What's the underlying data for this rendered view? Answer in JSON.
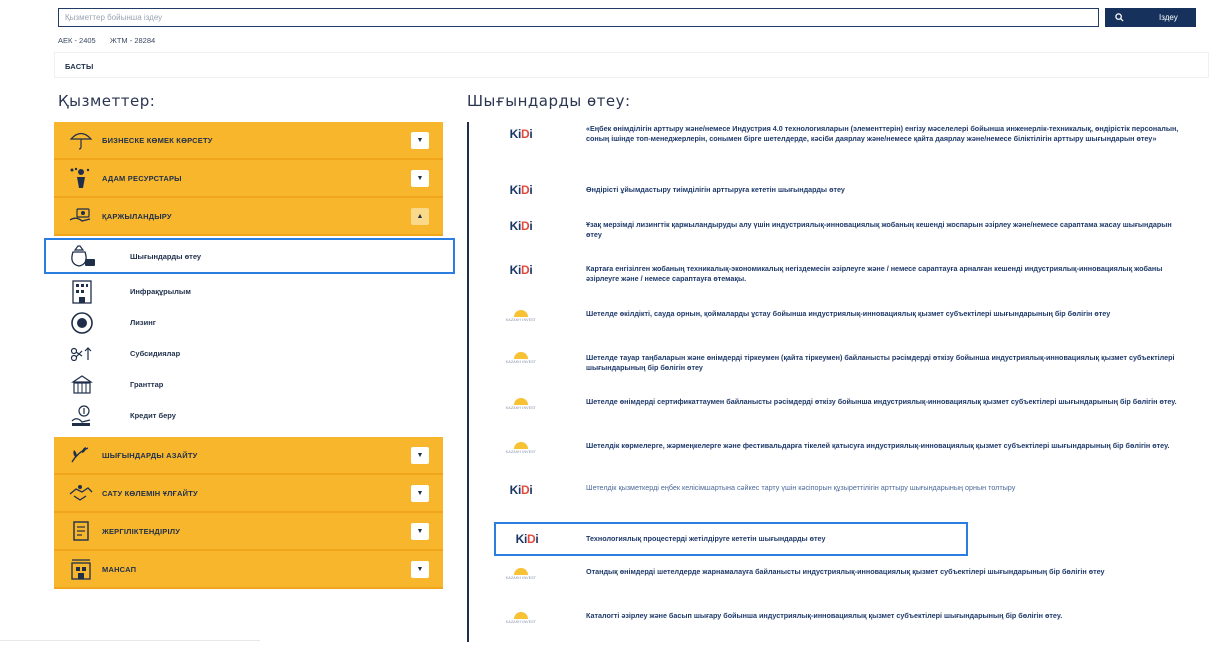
{
  "search": {
    "placeholder": "Қызметтер бойынша іздеу",
    "button_label": "Іздеу"
  },
  "rates": {
    "aek": "АЕК - 2405",
    "zhtm": "ЖТМ - 28284"
  },
  "breadcrumb": "БАСТЫ",
  "services": {
    "title": "Қызметтер:",
    "categories": [
      {
        "label": "БИЗНЕСКЕ КӨМЕК КӨРСЕТУ",
        "icon": "umbrella-icon",
        "open": false
      },
      {
        "label": "АДАМ РЕСУРСТАРЫ",
        "icon": "people-icon",
        "open": false
      },
      {
        "label": "ҚАРЖЫЛАНДЫРУ",
        "icon": "money-hand-icon",
        "open": true
      },
      {
        "label": "ШЫҒЫНДАРДЫ АЗАЙТУ",
        "icon": "plant-icon",
        "open": false
      },
      {
        "label": "САТУ КӨЛЕМІН ҰЛҒАЙТУ",
        "icon": "handshake-icon",
        "open": false
      },
      {
        "label": "ЖЕРГІЛІКТЕНДІРІЛУ",
        "icon": "document-icon",
        "open": false
      },
      {
        "label": "МАНСАП",
        "icon": "career-icon",
        "open": false
      }
    ],
    "subitems": [
      {
        "label": "Шығындарды өтеу",
        "icon": "money-bag-icon",
        "active": true
      },
      {
        "label": "Инфрақұрылым",
        "icon": "building-icon",
        "active": false
      },
      {
        "label": "Лизинг",
        "icon": "leasing-icon",
        "active": false
      },
      {
        "label": "Субсидиялар",
        "icon": "subsidy-icon",
        "active": false
      },
      {
        "label": "Гранттар",
        "icon": "grant-icon",
        "active": false
      },
      {
        "label": "Кредит беру",
        "icon": "credit-icon",
        "active": false
      }
    ]
  },
  "expenses": {
    "title": "Шығындарды өтеу:",
    "items": [
      {
        "logo": "KIDI",
        "text": "«Еңбек өнімділігін арттыру және/немесе Индустрия 4.0 технологияларын (элементтерін) енгізу мәселелері бойынша инженерлік-техникалық, өндірістік персоналын, соның ішінде топ-менеджерлерін, сонымен бірге шетелдерде, кәсіби даярлау және/немесе қайта даярлау және/немесе біліктілігін арттыру шығындарын өтеу»"
      },
      {
        "logo": "KIDI",
        "text": "Өндірісті ұйымдастыру тиімділігін арттыруға кететін шығындарды өтеу"
      },
      {
        "logo": "KIDI",
        "text": "Ұзақ мерзімді лизингтік қаржыландыруды алу үшін индустриялық-инновациялық жобаның кешенді жоспарын әзірлеу және/немесе сараптама жасау шығындарын өтеу"
      },
      {
        "logo": "KIDI",
        "text": "Картаға енгізілген жобаның техникалық-экономикалық негіздемесін әзірлеуге және / немесе сараптауға арналған кешенді индустриялық-инновациялық жобаны әзірлеуге және / немесе сараптауға өтемақы."
      },
      {
        "logo": "KAZAKH INVEST",
        "text": "Шетелде өкілдікті, сауда орнын, қоймаларды ұстау бойынша индустриялық-инновациялық қызмет субъектілері шығындарының бір бөлігін өтеу"
      },
      {
        "logo": "KAZAKH INVEST",
        "text": "Шетелде тауар таңбаларын және өнімдерді тіркеумен (қайта тіркеумен) байланысты рәсімдерді өткізу бойынша индустриялық-инновациялық қызмет субъектілері шығындарының бір бөлігін өтеу"
      },
      {
        "logo": "KAZAKH INVEST",
        "text": "Шетелде өнімдерді сертификаттаумен байланысты рәсімдерді өткізу бойынша индустриялық-инновациялық қызмет субъектілері шығындарының бір бөлігін өтеу."
      },
      {
        "logo": "KAZAKH INVEST",
        "text": "Шетелдік көрмелерге, жәрмеңкелерге және фестивальдарға тікелей қатысуға индустриялық-инновациялық қызмет субъектілері шығындарының бір бөлігін өтеу."
      },
      {
        "logo": "KIDI",
        "text": "Шетелдік қызметкерді еңбек келісімшартына сәйкес тарту үшін кәсіпорын құзыреттілігін арттыру шығындарының орнын толтыру"
      },
      {
        "logo": "KIDI",
        "text": "Технологиялық процестерді жетілдіруге кететін шығындарды өтеу"
      },
      {
        "logo": "KAZAKH INVEST",
        "text": "Отандық өнімдерді шетелдерде жарнамалауға байланысты индустриялық-инновациялық қызмет субъектілері шығындарының бір бөлігін өтеу"
      },
      {
        "logo": "KAZAKH INVEST",
        "text": "Каталогті әзірлеу және басып шығару бойынша индустриялық-инновациялық қызмет субъектілері шығындарының бір бөлігін өтеу."
      }
    ]
  },
  "colors": {
    "accent": "#f8b62d",
    "navy": "#16325c",
    "highlight": "#2a7de1",
    "kidi_red": "#e54b3c"
  }
}
